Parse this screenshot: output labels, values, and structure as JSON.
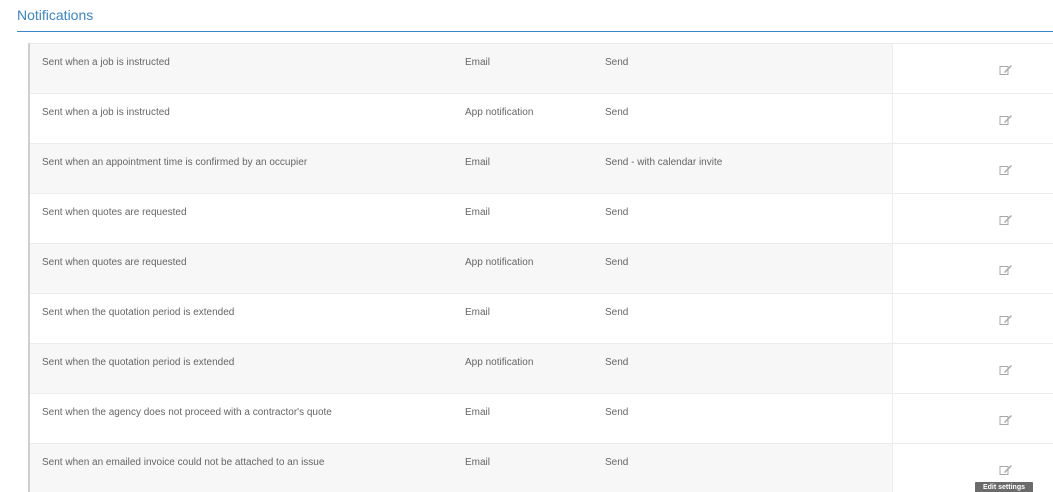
{
  "section": {
    "title": "Notifications"
  },
  "rows": [
    {
      "description": "Sent when a job is instructed",
      "channel": "Email",
      "action": "Send"
    },
    {
      "description": "Sent when a job is instructed",
      "channel": "App notification",
      "action": "Send"
    },
    {
      "description": "Sent when an appointment time is confirmed by an occupier",
      "channel": "Email",
      "action": "Send - with calendar invite"
    },
    {
      "description": "Sent when quotes are requested",
      "channel": "Email",
      "action": "Send"
    },
    {
      "description": "Sent when quotes are requested",
      "channel": "App notification",
      "action": "Send"
    },
    {
      "description": "Sent when the quotation period is extended",
      "channel": "Email",
      "action": "Send"
    },
    {
      "description": "Sent when the quotation period is extended",
      "channel": "App notification",
      "action": "Send"
    },
    {
      "description": "Sent when the agency does not proceed with a contractor's quote",
      "channel": "Email",
      "action": "Send"
    },
    {
      "description": "Sent when an emailed invoice could not be attached to an issue",
      "channel": "Email",
      "action": "Send"
    }
  ],
  "edit_icon": "edit-icon",
  "tooltip": {
    "text": "Edit settings"
  },
  "colors": {
    "accent": "#3a86c8",
    "row_alt": "#f7f7f7",
    "tooltip_bg": "#6b6b6b"
  }
}
